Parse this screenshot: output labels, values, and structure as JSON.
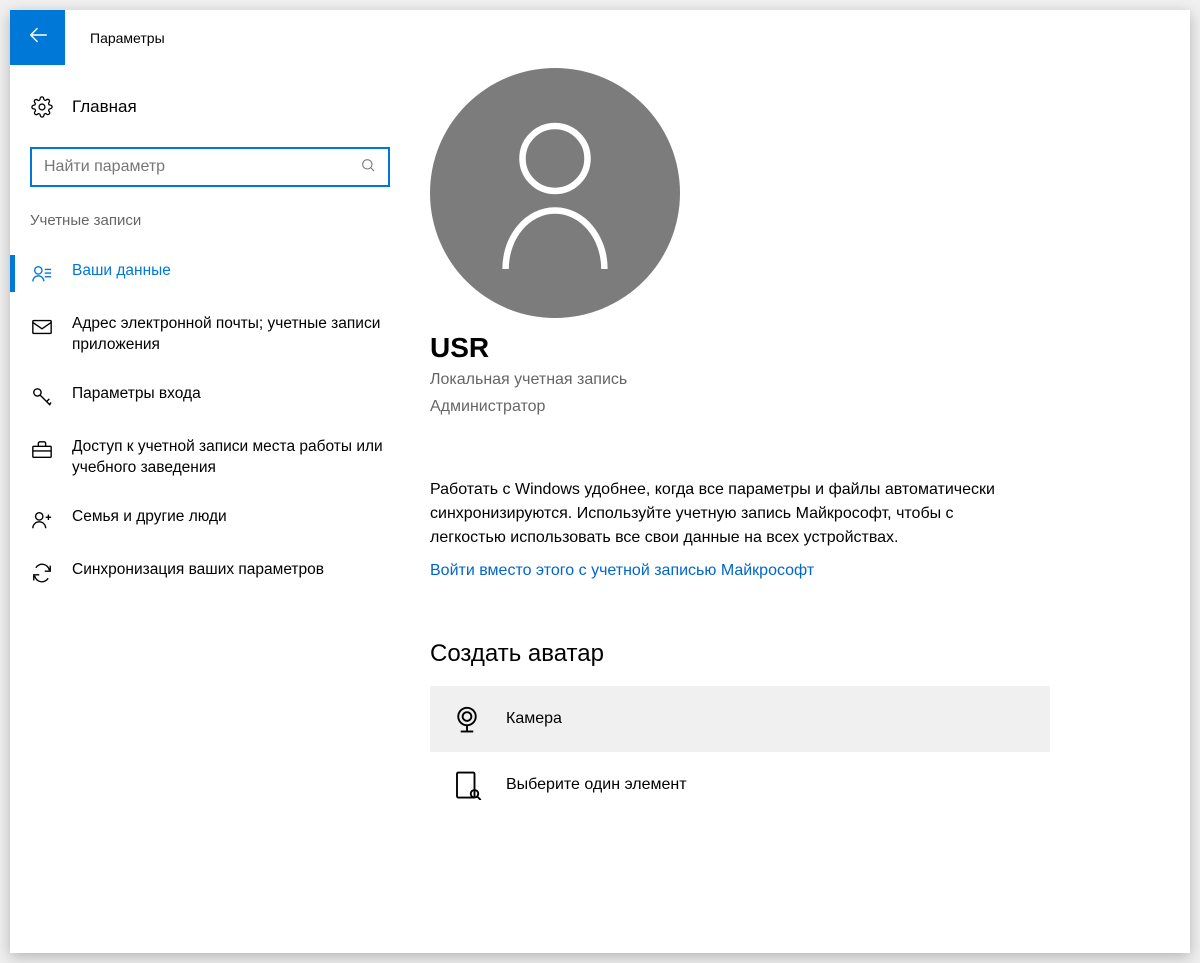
{
  "titlebar": {
    "title": "Параметры"
  },
  "sidebar": {
    "home_label": "Главная",
    "search_placeholder": "Найти параметр",
    "section_label": "Учетные записи",
    "items": [
      {
        "label": "Ваши данные"
      },
      {
        "label": "Адрес электронной почты; учетные записи приложения"
      },
      {
        "label": "Параметры входа"
      },
      {
        "label": "Доступ к учетной записи места работы или учебного заведения"
      },
      {
        "label": "Семья и другие люди"
      },
      {
        "label": "Синхронизация ваших параметров"
      }
    ]
  },
  "content": {
    "user_name": "USR",
    "account_type": "Локальная учетная запись",
    "account_role": "Администратор",
    "description": "Работать с Windows удобнее, когда все параметры и файлы автоматически синхронизируются. Используйте учетную запись Майкрософт, чтобы с легкостью использовать все свои данные на всех устройствах.",
    "signin_link": "Войти вместо этого с учетной записью Майкрософт",
    "avatar_heading": "Создать аватар",
    "options": [
      {
        "label": "Камера"
      },
      {
        "label": "Выберите один элемент"
      }
    ]
  }
}
